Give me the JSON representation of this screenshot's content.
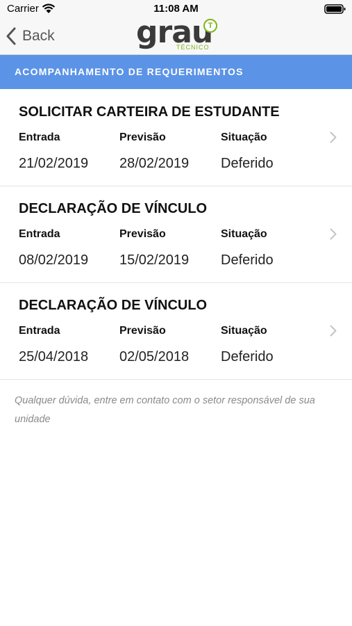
{
  "status_bar": {
    "carrier": "Carrier",
    "time": "11:08 AM"
  },
  "nav": {
    "back_label": "Back",
    "logo_text": "grau",
    "logo_badge": "T",
    "logo_subtext": "TÉCNICO"
  },
  "section": {
    "title": "ACOMPANHAMENTO DE REQUERIMENTOS"
  },
  "columns": {
    "entrada": "Entrada",
    "previsao": "Previsão",
    "situacao": "Situação"
  },
  "requests": [
    {
      "title": "SOLICITAR CARTEIRA DE ESTUDANTE",
      "entrada": "21/02/2019",
      "previsao": "28/02/2019",
      "situacao": "Deferido"
    },
    {
      "title": "DECLARAÇÃO DE VÍNCULO",
      "entrada": "08/02/2019",
      "previsao": "15/02/2019",
      "situacao": "Deferido"
    },
    {
      "title": "DECLARAÇÃO DE VÍNCULO",
      "entrada": "25/04/2018",
      "previsao": "02/05/2018",
      "situacao": "Deferido"
    }
  ],
  "footer": {
    "note": "Qualquer dúvida, entre em contato com o setor responsável de sua unidade"
  },
  "colors": {
    "header_blue": "#5b93e6",
    "logo_green": "#7cb518",
    "logo_gray": "#3a3a3a"
  },
  "icons": [
    "wifi-icon",
    "battery-icon",
    "back-chevron-icon",
    "chevron-right-icon"
  ]
}
